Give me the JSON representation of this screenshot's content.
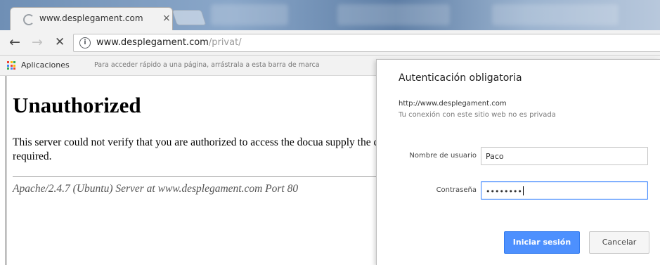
{
  "tab": {
    "title": "www.desplegament.com",
    "close_glyph": "×"
  },
  "toolbar": {
    "back_glyph": "←",
    "forward_glyph": "→",
    "stop_glyph": "✕",
    "info_glyph": "i",
    "url_host": "www.desplegament.com",
    "url_path": "/privat/"
  },
  "bookmarks": {
    "apps_label": "Aplicaciones",
    "hint": "Para acceder rápido a una página, arrástrala a esta barra de marca",
    "apps_colors": [
      "#ea4335",
      "#fbbc05",
      "#34a853",
      "#4285f4",
      "#ea4335",
      "#fbbc05",
      "#34a853",
      "#4285f4",
      "#ea4335"
    ]
  },
  "page": {
    "heading": "Unauthorized",
    "message": "This server could not verify that you are authorized to access the docua supply the credentials required.",
    "address": "Apache/2.4.7 (Ubuntu) Server at www.desplegament.com Port 80"
  },
  "auth": {
    "title": "Autenticación obligatoria",
    "origin": "http://www.desplegament.com",
    "privacy_note": "Tu conexión con este sitio web no es privada",
    "username_label": "Nombre de usuario",
    "username_value": "Paco",
    "password_label": "Contraseña",
    "password_value": "••••••••",
    "login_button": "Iniciar sesión",
    "cancel_button": "Cancelar"
  },
  "colors": {
    "accent": "#4d90fe",
    "focus_border": "#4d90fe",
    "url_path": "#9a9a9a"
  }
}
